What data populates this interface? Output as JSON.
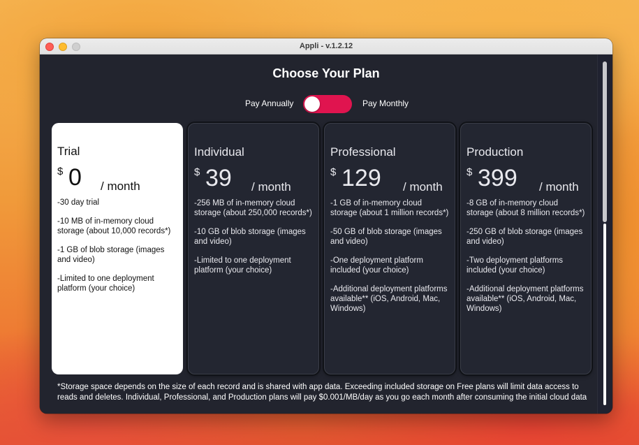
{
  "window": {
    "title": "Appli - v.1.2.12"
  },
  "heading": "Choose Your Plan",
  "billing": {
    "annual_label": "Pay Annually",
    "monthly_label": "Pay Monthly"
  },
  "plans": [
    {
      "name": "Trial",
      "currency": "$",
      "price": "0",
      "unit": "/ month",
      "features": [
        "-30 day trial",
        "-10 MB of in-memory cloud storage (about 10,000 records*)",
        "-1 GB of blob storage (images and video)",
        "-Limited to one deployment platform (your choice)"
      ]
    },
    {
      "name": "Individual",
      "currency": "$",
      "price": "39",
      "unit": "/ month",
      "features": [
        "-256 MB of in-memory cloud storage (about 250,000 records*)",
        "-10 GB of blob storage (images and video)",
        "-Limited to one deployment platform (your choice)"
      ]
    },
    {
      "name": "Professional",
      "currency": "$",
      "price": "129",
      "unit": "/ month",
      "features": [
        "-1 GB of in-memory cloud storage (about 1 million records*)",
        "-50 GB of blob storage (images and video)",
        "-One deployment platform included (your choice)",
        "-Additional deployment platforms available** (iOS, Android, Mac, Windows)"
      ]
    },
    {
      "name": "Production",
      "currency": "$",
      "price": "399",
      "unit": "/ month",
      "features": [
        "-8 GB of in-memory cloud storage (about 8 million records*)",
        "-250 GB of blob storage (images and video)",
        "-Two deployment platforms included (your choice)",
        "-Additional deployment platforms available** (iOS, Android, Mac, Windows)"
      ]
    }
  ],
  "footnote": "*Storage space depends on the size of each record and is shared with app data. Exceeding included storage on Free plans will limit data access to reads and deletes. Individual, Professional, and Production plans will pay $0.001/MB/day as you go each month after consuming the initial cloud data",
  "colors": {
    "toggle_active": "#e0144f",
    "panel_bg": "#22242e",
    "card_bg": "#232631",
    "selected_card_bg": "#ffffff"
  }
}
